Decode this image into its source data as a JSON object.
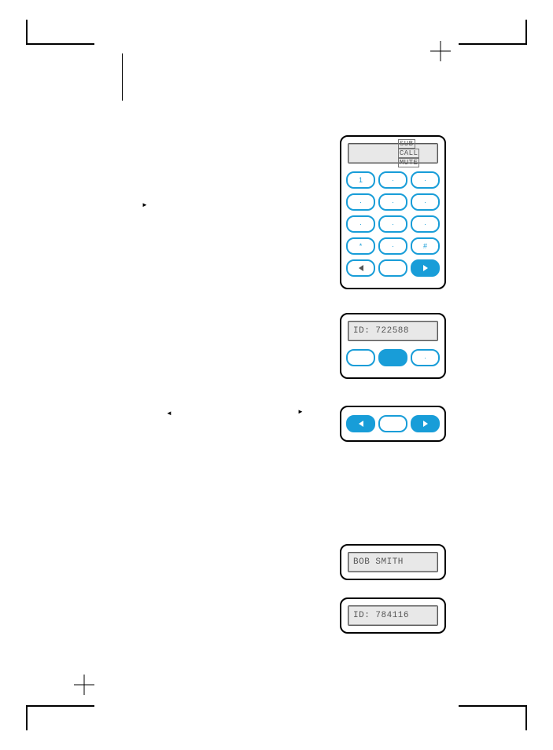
{
  "lcd_status": {
    "sub": "SUB",
    "call": "CALL",
    "mute": "MUTE"
  },
  "keypad": {
    "rows": [
      [
        "1",
        "·",
        "·"
      ],
      [
        "·",
        "·",
        "·"
      ],
      [
        "·",
        "·",
        "·"
      ],
      [
        "*",
        "·",
        "#"
      ]
    ],
    "nav": {
      "left": "◄",
      "center": "",
      "right": "►"
    }
  },
  "device2": {
    "lcd": "ID: 722588",
    "soft": {
      "left": "",
      "center": "",
      "right": "·"
    }
  },
  "device3": {
    "nav": {
      "left": "◄",
      "center": "",
      "right": "►"
    }
  },
  "lcd_name": "BOB SMITH",
  "lcd_id": "ID: 784116"
}
